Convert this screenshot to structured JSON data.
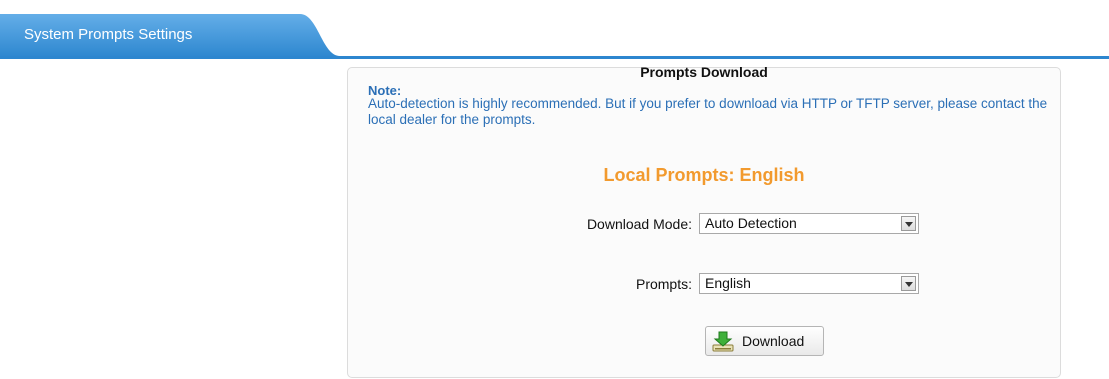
{
  "header": {
    "tab_title": "System Prompts Settings"
  },
  "panel": {
    "title": "Prompts Download",
    "note_label": "Note:",
    "note_text": "Auto-detection is highly recommended. But if you prefer to download via HTTP or TFTP server, please contact the local dealer for the prompts.",
    "local_prompts": "Local Prompts: English",
    "download_mode": {
      "label": "Download Mode:",
      "value": "Auto Detection"
    },
    "prompts": {
      "label": "Prompts:",
      "value": "English"
    },
    "download_button_label": "Download"
  },
  "colors": {
    "accent": "#2f88d0",
    "note": "#2b6fb6",
    "highlight": "#f29a2e"
  },
  "icons": {
    "download": "download-arrow-icon",
    "dropdown": "chevron-down-icon"
  }
}
